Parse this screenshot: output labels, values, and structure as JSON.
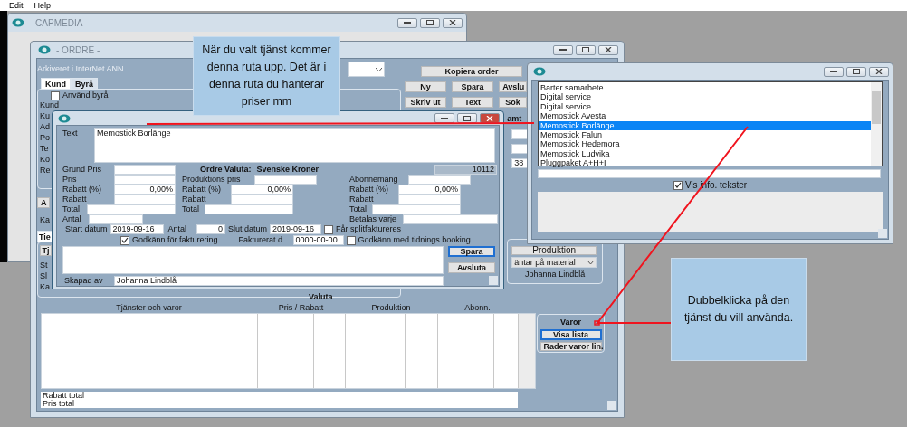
{
  "menu": [
    {
      "label": "Edit"
    },
    {
      "label": "Help"
    }
  ],
  "capmedia_window": {
    "title": "- CAPMEDIA -",
    "active": false
  },
  "order_window": {
    "title": "- ORDRE -",
    "active": false,
    "archive_note": "Arkiveret i InterNet ANN",
    "copy_button": "Kopiera order",
    "action_rows": [
      [
        "Ny",
        "Spara",
        "Avslu"
      ],
      [
        "Skriv ut",
        "Text",
        "Sök"
      ]
    ],
    "tabs": [
      {
        "label": "Kund",
        "selected": true
      },
      {
        "label": "Byrå",
        "selected": false
      }
    ],
    "use_agency": {
      "label": "Använd byrå",
      "checked": false
    },
    "customer_labels": [
      "Kund",
      "Ku",
      "Ad",
      "Po",
      "Te",
      "Ko",
      "Re"
    ],
    "side_button": "A",
    "side_label": "Ka",
    "lower_tab": {
      "label": "Tie",
      "selected": true
    },
    "lower_button": "Tj",
    "lower_labels": [
      "St",
      "Sl",
      "Ka"
    ],
    "right_label": "amt",
    "right_value": "38",
    "valuta_label": "Valuta",
    "production": {
      "header": "Produktion",
      "status": "äntar på material",
      "creator": "Johanna Lindblå"
    },
    "table": {
      "columns": [
        "Tjänster och varor",
        "Pris / Rabatt",
        "Produktion",
        "Abonn."
      ]
    },
    "totals": [
      "Rabatt total",
      "Pris total"
    ],
    "varor": {
      "title": "Varor",
      "buttons": [
        {
          "label": "Visa lista",
          "selected": true
        },
        {
          "label": "Rader varor lin.",
          "selected": false
        }
      ]
    }
  },
  "price_window": {
    "active": true,
    "text_label": "Text",
    "text_value": "Memostick Borlänge",
    "base_price_label": "Grund Pris",
    "currency_label": "Ordre Valuta:",
    "currency": "Svenske Kroner",
    "number": "10112",
    "columns": [
      {
        "fields": [
          {
            "label": "Pris"
          },
          {
            "label": "Rabatt (%)",
            "value": "0,00%"
          },
          {
            "label": "Rabatt"
          },
          {
            "label": "Total"
          }
        ]
      },
      {
        "fields": [
          {
            "label": "Produktions pris"
          },
          {
            "label": "Rabatt (%)",
            "value": "0,00%"
          },
          {
            "label": "Rabatt"
          },
          {
            "label": "Total"
          }
        ]
      },
      {
        "fields": [
          {
            "label": "Abonnemang"
          },
          {
            "label": "Rabatt (%)",
            "value": "0,00%"
          },
          {
            "label": "Rabatt"
          },
          {
            "label": "Total"
          }
        ]
      }
    ],
    "quantity_label": "Antal",
    "pay_every_label": "Betalas varje",
    "start_label": "Start datum",
    "start": "2019-09-16",
    "count_label": "Antal",
    "count": "0",
    "end_label": "Slut datum",
    "end": "2019-09-16",
    "approve": {
      "label": "Godkänn för fakturering",
      "checked": true
    },
    "invoiced_label": "Fakturerat d.",
    "invoiced": "0000-00-00",
    "checks": [
      {
        "label": "Får splitfaktureres",
        "checked": false
      },
      {
        "label": "Godkänn med tidnings booking",
        "checked": false
      }
    ],
    "buttons": [
      {
        "label": "Spara",
        "selected": true
      },
      {
        "label": "Avsluta",
        "selected": false
      }
    ],
    "created_label": "Skapad av",
    "created_by": "Johanna Lindblå"
  },
  "list_window": {
    "active": false,
    "items": [
      {
        "label": "Barter samarbete",
        "selected": false
      },
      {
        "label": "Digital service",
        "selected": false
      },
      {
        "label": "Digital service",
        "selected": false
      },
      {
        "label": "Memostick Avesta",
        "selected": false
      },
      {
        "label": "Memostick Borlänge",
        "selected": true
      },
      {
        "label": "Memostick Falun",
        "selected": false
      },
      {
        "label": "Memostick Hedemora",
        "selected": false
      },
      {
        "label": "Memostick Ludvika",
        "selected": false
      },
      {
        "label": "Pluggpaket A+H+I",
        "selected": false
      }
    ],
    "show_info": {
      "label": "Vis info. tekster",
      "checked": true
    }
  },
  "top_callout": {
    "text": "När du valt tjänst kommer denna ruta upp. Det är i denna ruta du hanterar priser mm"
  },
  "bottom_callout": {
    "text": "Dubbelklicka på den tjänst du vill använda."
  }
}
